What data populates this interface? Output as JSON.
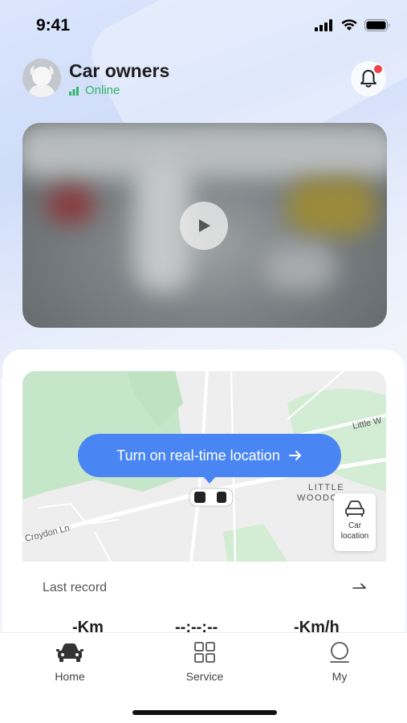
{
  "status_bar": {
    "time": "9:41"
  },
  "header": {
    "user_name": "Car owners",
    "status": "Online"
  },
  "video": {
    "play_icon": "play-icon"
  },
  "map": {
    "cta_label": "Turn on real-time location",
    "car_location_label": "Car location",
    "street_labels": [
      "Little W",
      "LITTLE",
      "WOODCOTE",
      "Croydon Ln"
    ]
  },
  "last_record": {
    "title": "Last record",
    "distance": "-Km",
    "duration": "--:--:--",
    "speed": "-Km/h"
  },
  "tabs": [
    {
      "label": "Home",
      "icon": "car-icon",
      "active": true
    },
    {
      "label": "Service",
      "icon": "grid-icon",
      "active": false
    },
    {
      "label": "My",
      "icon": "person-icon",
      "active": false
    }
  ],
  "colors": {
    "accent": "#4a86f3",
    "online": "#2fb66a",
    "badge": "#f0424a"
  }
}
